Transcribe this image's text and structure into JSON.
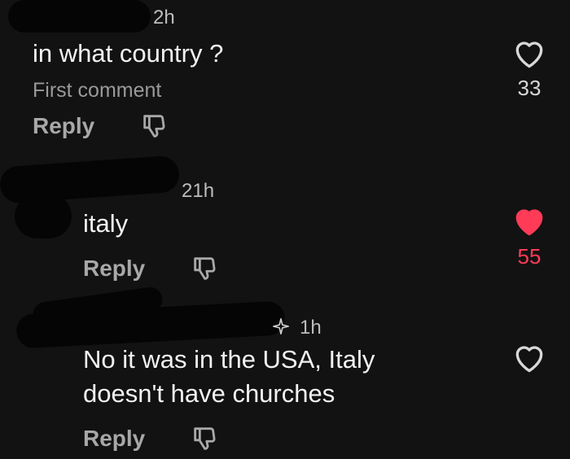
{
  "comments": [
    {
      "timestamp": "2h",
      "text": "in what country ?",
      "subtext": "First comment",
      "reply_label": "Reply",
      "like_count": "33",
      "liked": false
    },
    {
      "timestamp": "21h",
      "text": "italy",
      "reply_label": "Reply",
      "like_count": "55",
      "liked": true
    },
    {
      "timestamp": "1h",
      "text_line1": "No it was in the USA, Italy",
      "text_line2": "doesn't have churches",
      "reply_label": "Reply",
      "liked": false
    }
  ],
  "colors": {
    "like_active": "#ff3b57",
    "background": "#121212"
  },
  "icons": [
    "dislike-icon",
    "heart-icon",
    "heart-filled-icon",
    "sparkle-icon"
  ]
}
